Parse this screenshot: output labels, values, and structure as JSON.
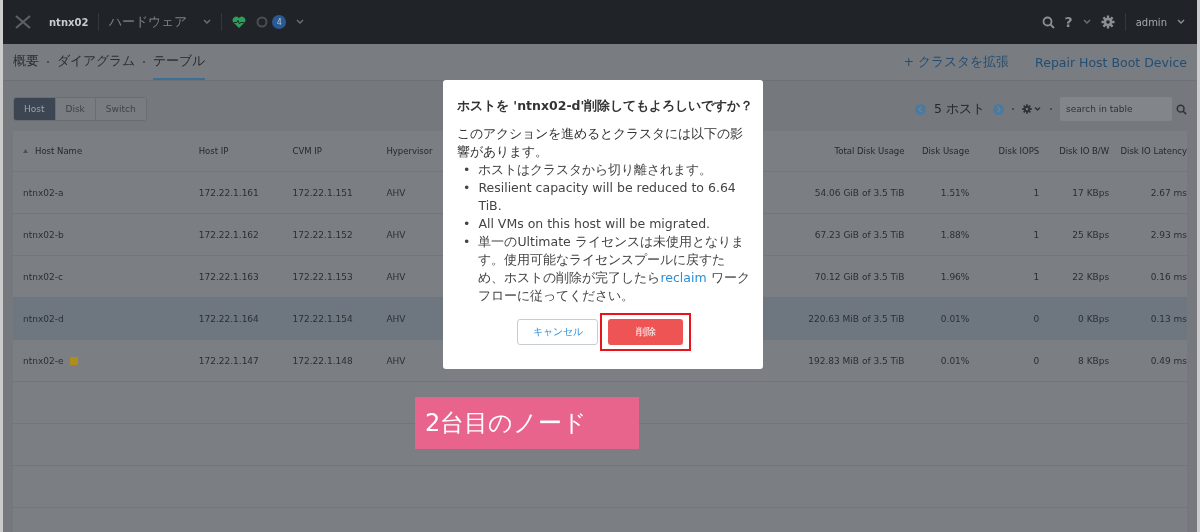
{
  "top_bar": {
    "cluster": "ntnx02",
    "section": "ハードウェア",
    "alert_count": "4",
    "user": "admin",
    "help": "?"
  },
  "subnav": {
    "tabs": [
      {
        "label": "概要",
        "selected": false
      },
      {
        "label": "ダイアグラム",
        "selected": false
      },
      {
        "label": "テーブル",
        "selected": true
      }
    ],
    "actions": [
      "+ クラスタを拡張",
      "Repair Host Boot Device"
    ]
  },
  "view_tabs": [
    {
      "label": "Host",
      "selected": true
    },
    {
      "label": "Disk",
      "selected": false
    },
    {
      "label": "Switch",
      "selected": false
    }
  ],
  "pager": {
    "count": "5 ホスト"
  },
  "search": {
    "placeholder": "search in table"
  },
  "table": {
    "columns": [
      "Host Name",
      "Host IP",
      "CVM IP",
      "Hypervisor",
      "Total Disk Usage",
      "Disk Usage",
      "Disk IOPS",
      "Disk IO B/W",
      "Disk IO Latency"
    ],
    "rows": [
      {
        "selected": false,
        "warning": false,
        "cells": [
          "ntnx02-a",
          "172.22.1.161",
          "172.22.1.151",
          "AHV",
          "54.06 GiB of 3.5 TiB",
          "1.51%",
          "1",
          "17 KBps",
          "2.67 ms"
        ]
      },
      {
        "selected": false,
        "warning": false,
        "cells": [
          "ntnx02-b",
          "172.22.1.162",
          "172.22.1.152",
          "AHV",
          "67.23 GiB of 3.5 TiB",
          "1.88%",
          "1",
          "25 KBps",
          "2.93 ms"
        ]
      },
      {
        "selected": false,
        "warning": false,
        "cells": [
          "ntnx02-c",
          "172.22.1.163",
          "172.22.1.153",
          "AHV",
          "70.12 GiB of 3.5 TiB",
          "1.96%",
          "1",
          "22 KBps",
          "0.16 ms"
        ]
      },
      {
        "selected": true,
        "warning": false,
        "cells": [
          "ntnx02-d",
          "172.22.1.164",
          "172.22.1.154",
          "AHV",
          "220.63 MiB of 3.5 TiB",
          "0.01%",
          "0",
          "0 KBps",
          "0.13 ms"
        ]
      },
      {
        "selected": false,
        "warning": true,
        "cells": [
          "ntnx02-e",
          "172.22.1.147",
          "172.22.1.148",
          "AHV",
          "192.83 MiB of 3.5 TiB",
          "0.01%",
          "0",
          "8 KBps",
          "0.49 ms"
        ]
      }
    ]
  },
  "dialog": {
    "title": "ホストを 'ntnx02-d'削除してもよろしいですか？",
    "intro": "このアクションを進めるとクラスタには以下の影響があります。",
    "bullet": "•",
    "bullets": [
      {
        "text": "ホストはクラスタから切り離されます。"
      },
      {
        "text": "Resilient capacity will be reduced to 6.64 TiB."
      },
      {
        "text": "All VMs on this host will be migrated."
      },
      {
        "text": "単一のUltimate ライセンスは未使用となります。使用可能なライセンスプールに戻すため、ホストの削除が完了したら",
        "link": "reclaim",
        "text_after": " ワークフローに従ってください。"
      }
    ],
    "cancel": "キャンセル",
    "confirm": "削除"
  },
  "annotation": {
    "label": "2台目のノード"
  }
}
